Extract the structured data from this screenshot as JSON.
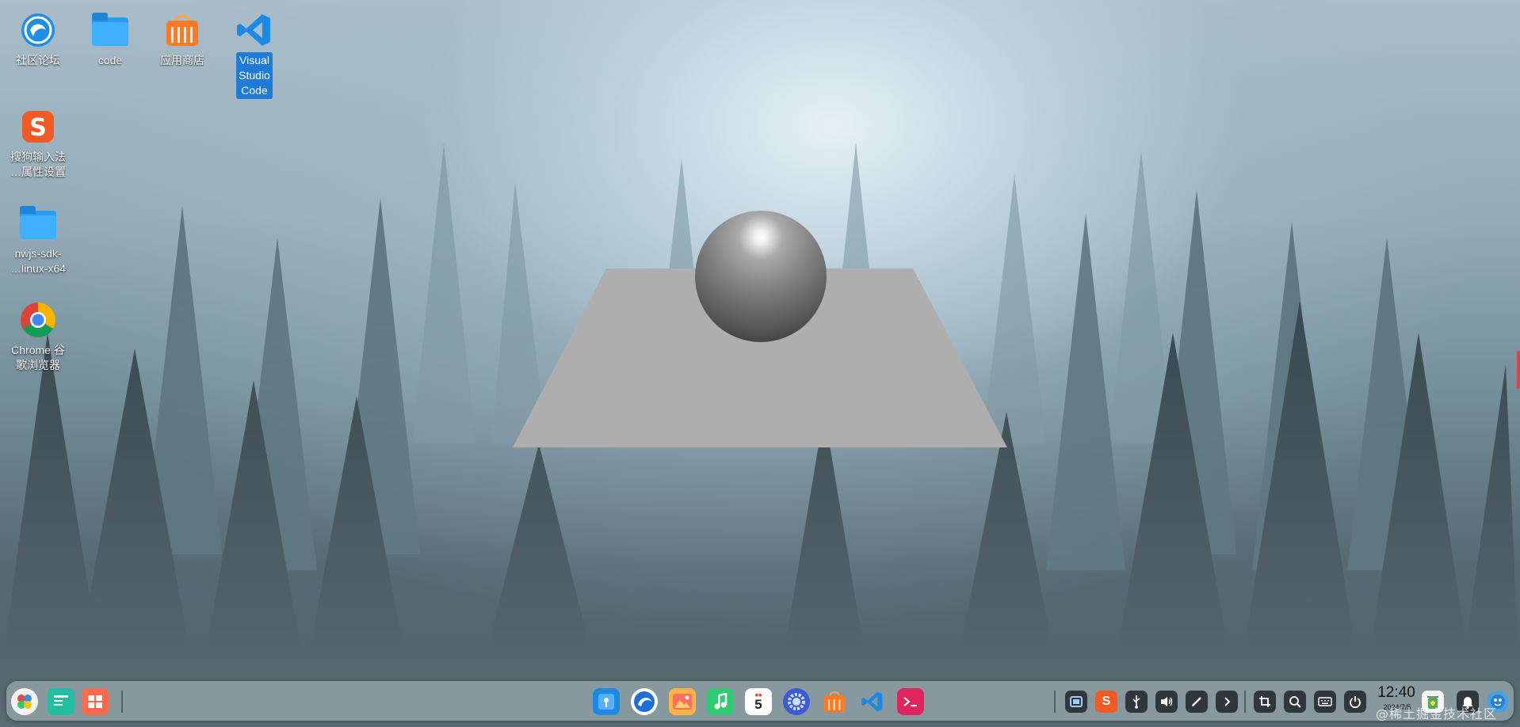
{
  "desktop": {
    "icons": [
      {
        "label": "社区论坛",
        "icon": "deepin-forum-icon"
      },
      {
        "label": "code",
        "icon": "folder-icon"
      },
      {
        "label": "应用商店",
        "icon": "app-store-icon"
      },
      {
        "label": "Visual Studio Code",
        "icon": "vscode-icon"
      },
      {
        "label": "搜狗输入法\n…属性设置",
        "icon": "sogou-icon"
      },
      {
        "label": "nwjs-sdk-\n…linux-x64",
        "icon": "folder-icon"
      },
      {
        "label": "Chrome 谷\n歌浏览器",
        "icon": "chrome-icon"
      }
    ]
  },
  "scene": {
    "plane_color": "#aeaeae",
    "sphere_color": "#7d7d7d"
  },
  "taskbar": {
    "left_apps": [
      "launcher-icon",
      "multitasking-view-icon",
      "workspace-icon"
    ],
    "dock_apps": [
      "file-manager-icon",
      "browser-icon",
      "image-viewer-icon",
      "music-icon",
      "calendar-icon",
      "settings-icon",
      "app-store-icon",
      "vscode-icon",
      "terminal-icon"
    ],
    "calendar_day": "5",
    "tray": [
      "screenshot-icon",
      "sogou-tray-icon",
      "usb-icon",
      "volume-icon",
      "pen-icon",
      "expand-arrow-icon",
      "crop-icon",
      "search-icon",
      "keyboard-icon",
      "power-icon"
    ],
    "clock": {
      "time": "12:40",
      "date": "2024/7/5"
    },
    "notification_icon": "bell-icon",
    "watermark": "@稀土掘金技术社区"
  }
}
